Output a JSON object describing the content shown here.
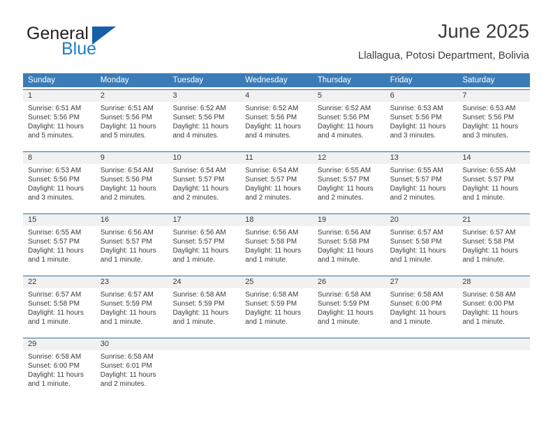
{
  "brand": {
    "line1": "General",
    "line2": "Blue",
    "logo_icon": "triangle-logo-icon",
    "colors": {
      "dark": "#231f20",
      "blue": "#1c7fc4",
      "triangle": "#1460a8"
    }
  },
  "header": {
    "title": "June 2025",
    "subtitle": "Llallagua, Potosi Department, Bolivia"
  },
  "colors": {
    "header_bar": "#3b7cb8",
    "row_rule": "#2e6da4",
    "daynum_band": "#f1f1f1",
    "text": "#3a3a3a"
  },
  "calendar": {
    "weekdays": [
      "Sunday",
      "Monday",
      "Tuesday",
      "Wednesday",
      "Thursday",
      "Friday",
      "Saturday"
    ],
    "weeks": [
      [
        {
          "day": "1",
          "sunrise": "Sunrise: 6:51 AM",
          "sunset": "Sunset: 5:56 PM",
          "daylight": "Daylight: 11 hours and 5 minutes."
        },
        {
          "day": "2",
          "sunrise": "Sunrise: 6:51 AM",
          "sunset": "Sunset: 5:56 PM",
          "daylight": "Daylight: 11 hours and 5 minutes."
        },
        {
          "day": "3",
          "sunrise": "Sunrise: 6:52 AM",
          "sunset": "Sunset: 5:56 PM",
          "daylight": "Daylight: 11 hours and 4 minutes."
        },
        {
          "day": "4",
          "sunrise": "Sunrise: 6:52 AM",
          "sunset": "Sunset: 5:56 PM",
          "daylight": "Daylight: 11 hours and 4 minutes."
        },
        {
          "day": "5",
          "sunrise": "Sunrise: 6:52 AM",
          "sunset": "Sunset: 5:56 PM",
          "daylight": "Daylight: 11 hours and 4 minutes."
        },
        {
          "day": "6",
          "sunrise": "Sunrise: 6:53 AM",
          "sunset": "Sunset: 5:56 PM",
          "daylight": "Daylight: 11 hours and 3 minutes."
        },
        {
          "day": "7",
          "sunrise": "Sunrise: 6:53 AM",
          "sunset": "Sunset: 5:56 PM",
          "daylight": "Daylight: 11 hours and 3 minutes."
        }
      ],
      [
        {
          "day": "8",
          "sunrise": "Sunrise: 6:53 AM",
          "sunset": "Sunset: 5:56 PM",
          "daylight": "Daylight: 11 hours and 3 minutes."
        },
        {
          "day": "9",
          "sunrise": "Sunrise: 6:54 AM",
          "sunset": "Sunset: 5:56 PM",
          "daylight": "Daylight: 11 hours and 2 minutes."
        },
        {
          "day": "10",
          "sunrise": "Sunrise: 6:54 AM",
          "sunset": "Sunset: 5:57 PM",
          "daylight": "Daylight: 11 hours and 2 minutes."
        },
        {
          "day": "11",
          "sunrise": "Sunrise: 6:54 AM",
          "sunset": "Sunset: 5:57 PM",
          "daylight": "Daylight: 11 hours and 2 minutes."
        },
        {
          "day": "12",
          "sunrise": "Sunrise: 6:55 AM",
          "sunset": "Sunset: 5:57 PM",
          "daylight": "Daylight: 11 hours and 2 minutes."
        },
        {
          "day": "13",
          "sunrise": "Sunrise: 6:55 AM",
          "sunset": "Sunset: 5:57 PM",
          "daylight": "Daylight: 11 hours and 2 minutes."
        },
        {
          "day": "14",
          "sunrise": "Sunrise: 6:55 AM",
          "sunset": "Sunset: 5:57 PM",
          "daylight": "Daylight: 11 hours and 1 minute."
        }
      ],
      [
        {
          "day": "15",
          "sunrise": "Sunrise: 6:55 AM",
          "sunset": "Sunset: 5:57 PM",
          "daylight": "Daylight: 11 hours and 1 minute."
        },
        {
          "day": "16",
          "sunrise": "Sunrise: 6:56 AM",
          "sunset": "Sunset: 5:57 PM",
          "daylight": "Daylight: 11 hours and 1 minute."
        },
        {
          "day": "17",
          "sunrise": "Sunrise: 6:56 AM",
          "sunset": "Sunset: 5:57 PM",
          "daylight": "Daylight: 11 hours and 1 minute."
        },
        {
          "day": "18",
          "sunrise": "Sunrise: 6:56 AM",
          "sunset": "Sunset: 5:58 PM",
          "daylight": "Daylight: 11 hours and 1 minute."
        },
        {
          "day": "19",
          "sunrise": "Sunrise: 6:56 AM",
          "sunset": "Sunset: 5:58 PM",
          "daylight": "Daylight: 11 hours and 1 minute."
        },
        {
          "day": "20",
          "sunrise": "Sunrise: 6:57 AM",
          "sunset": "Sunset: 5:58 PM",
          "daylight": "Daylight: 11 hours and 1 minute."
        },
        {
          "day": "21",
          "sunrise": "Sunrise: 6:57 AM",
          "sunset": "Sunset: 5:58 PM",
          "daylight": "Daylight: 11 hours and 1 minute."
        }
      ],
      [
        {
          "day": "22",
          "sunrise": "Sunrise: 6:57 AM",
          "sunset": "Sunset: 5:58 PM",
          "daylight": "Daylight: 11 hours and 1 minute."
        },
        {
          "day": "23",
          "sunrise": "Sunrise: 6:57 AM",
          "sunset": "Sunset: 5:59 PM",
          "daylight": "Daylight: 11 hours and 1 minute."
        },
        {
          "day": "24",
          "sunrise": "Sunrise: 6:58 AM",
          "sunset": "Sunset: 5:59 PM",
          "daylight": "Daylight: 11 hours and 1 minute."
        },
        {
          "day": "25",
          "sunrise": "Sunrise: 6:58 AM",
          "sunset": "Sunset: 5:59 PM",
          "daylight": "Daylight: 11 hours and 1 minute."
        },
        {
          "day": "26",
          "sunrise": "Sunrise: 6:58 AM",
          "sunset": "Sunset: 5:59 PM",
          "daylight": "Daylight: 11 hours and 1 minute."
        },
        {
          "day": "27",
          "sunrise": "Sunrise: 6:58 AM",
          "sunset": "Sunset: 6:00 PM",
          "daylight": "Daylight: 11 hours and 1 minute."
        },
        {
          "day": "28",
          "sunrise": "Sunrise: 6:58 AM",
          "sunset": "Sunset: 6:00 PM",
          "daylight": "Daylight: 11 hours and 1 minute."
        }
      ],
      [
        {
          "day": "29",
          "sunrise": "Sunrise: 6:58 AM",
          "sunset": "Sunset: 6:00 PM",
          "daylight": "Daylight: 11 hours and 1 minute."
        },
        {
          "day": "30",
          "sunrise": "Sunrise: 6:58 AM",
          "sunset": "Sunset: 6:01 PM",
          "daylight": "Daylight: 11 hours and 2 minutes."
        },
        {
          "day": "",
          "sunrise": "",
          "sunset": "",
          "daylight": ""
        },
        {
          "day": "",
          "sunrise": "",
          "sunset": "",
          "daylight": ""
        },
        {
          "day": "",
          "sunrise": "",
          "sunset": "",
          "daylight": ""
        },
        {
          "day": "",
          "sunrise": "",
          "sunset": "",
          "daylight": ""
        },
        {
          "day": "",
          "sunrise": "",
          "sunset": "",
          "daylight": ""
        }
      ]
    ]
  }
}
